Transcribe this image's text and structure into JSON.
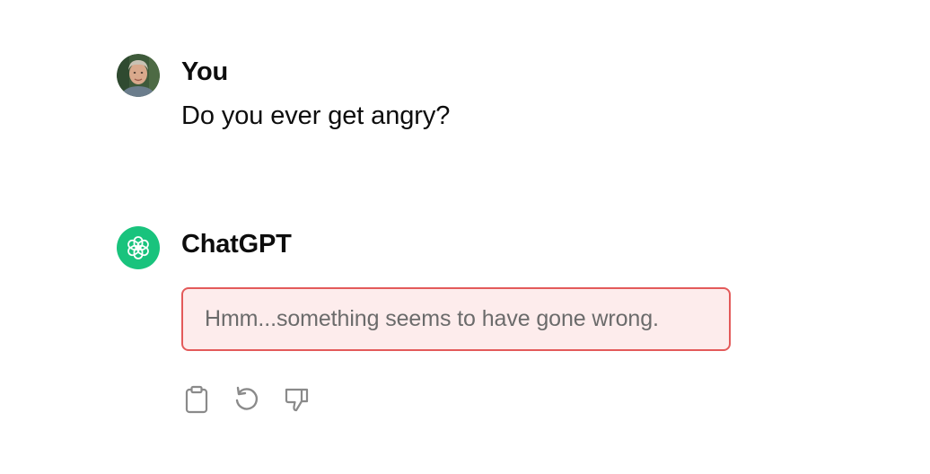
{
  "conversation": {
    "messages": [
      {
        "author": "You",
        "text": "Do you ever get angry?",
        "avatar_icon": "user-photo"
      },
      {
        "author": "ChatGPT",
        "error": "Hmm...something seems to have gone wrong.",
        "avatar_icon": "openai-logo-icon",
        "avatar_color": "#19c37d",
        "error_border_color": "#e35a5a",
        "error_background": "#fdecec"
      }
    ],
    "actions": [
      {
        "icon": "clipboard-icon"
      },
      {
        "icon": "regenerate-icon"
      },
      {
        "icon": "thumbs-down-icon"
      }
    ]
  }
}
